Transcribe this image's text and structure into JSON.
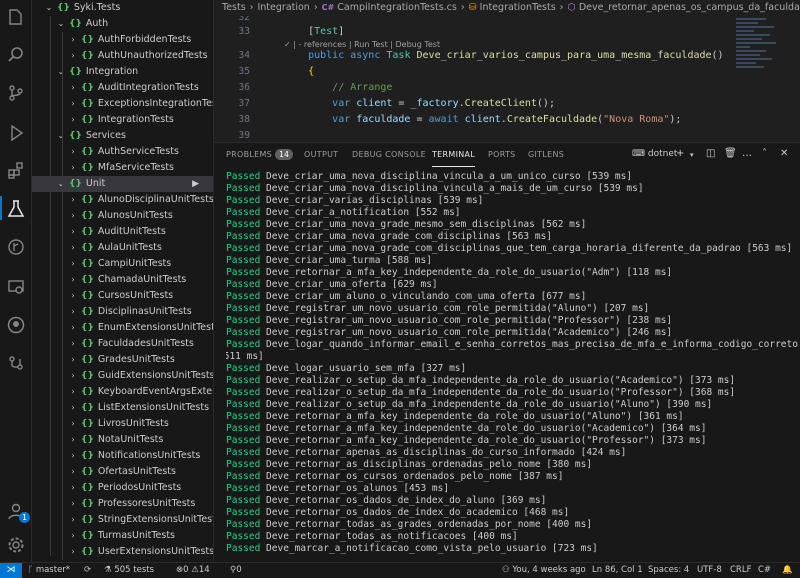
{
  "sidebar": {
    "items": [
      {
        "label": "Syki.Tests",
        "level": 0,
        "open": true
      },
      {
        "label": "Auth",
        "level": 1,
        "open": true
      },
      {
        "label": "AuthForbiddenTests",
        "level": 2
      },
      {
        "label": "AuthUnauthorizedTests",
        "level": 2
      },
      {
        "label": "Integration",
        "level": 1,
        "open": true
      },
      {
        "label": "AuditIntegrationTests",
        "level": 2
      },
      {
        "label": "ExceptionsIntegrationTests",
        "level": 2
      },
      {
        "label": "IntegrationTests",
        "level": 2
      },
      {
        "label": "Services",
        "level": 1,
        "open": true
      },
      {
        "label": "AuthServiceTests",
        "level": 2
      },
      {
        "label": "MfaServiceTests",
        "level": 2
      },
      {
        "label": "Unit",
        "level": 1,
        "open": true,
        "selected": true
      },
      {
        "label": "AlunoDisciplinaUnitTests",
        "level": 2
      },
      {
        "label": "AlunosUnitTests",
        "level": 2
      },
      {
        "label": "AuditUnitTests",
        "level": 2
      },
      {
        "label": "AulaUnitTests",
        "level": 2
      },
      {
        "label": "CampiUnitTests",
        "level": 2
      },
      {
        "label": "ChamadaUnitTests",
        "level": 2
      },
      {
        "label": "CursosUnitTests",
        "level": 2
      },
      {
        "label": "DisciplinasUnitTests",
        "level": 2
      },
      {
        "label": "EnumExtensionsUnitTests",
        "level": 2
      },
      {
        "label": "FaculdadesUnitTests",
        "level": 2
      },
      {
        "label": "GradesUnitTests",
        "level": 2
      },
      {
        "label": "GuidExtensionsUnitTests",
        "level": 2
      },
      {
        "label": "KeyboardEventArgsExten...",
        "level": 2
      },
      {
        "label": "ListExtensionsUnitTests",
        "level": 2
      },
      {
        "label": "LivrosUnitTests",
        "level": 2
      },
      {
        "label": "NotaUnitTests",
        "level": 2
      },
      {
        "label": "NotificationsUnitTests",
        "level": 2
      },
      {
        "label": "OfertasUnitTests",
        "level": 2
      },
      {
        "label": "PeriodosUnitTests",
        "level": 2
      },
      {
        "label": "ProfessoresUnitTests",
        "level": 2
      },
      {
        "label": "StringExtensionsUnitTests",
        "level": 2
      },
      {
        "label": "TurmasUnitTests",
        "level": 2
      },
      {
        "label": "UserExtensionsUnitTests",
        "level": 2
      }
    ]
  },
  "breadcrumb": {
    "p1": "Tests",
    "p2": "Integration",
    "file_icon": "C#",
    "file": "CampiIntegrationTests.cs",
    "cls": "IntegrationTests",
    "method": "Deve_retornar_apenas_os_campus_da_faculdade_do_usuario"
  },
  "editor": {
    "lines": [
      {
        "num": "32",
        "parts": []
      },
      {
        "num": "33",
        "parts": [
          {
            "t": "    ",
            "c": "pun"
          },
          {
            "t": "[",
            "c": "pun"
          },
          {
            "t": "Test",
            "c": "ty"
          },
          {
            "t": "]",
            "c": "pun"
          }
        ]
      },
      {
        "num": "34",
        "parts": [
          {
            "t": "    ",
            "c": "pun"
          },
          {
            "t": "public",
            "c": "kw"
          },
          {
            "t": " ",
            "c": "pun"
          },
          {
            "t": "async",
            "c": "kw"
          },
          {
            "t": " ",
            "c": "pun"
          },
          {
            "t": "Task",
            "c": "ty"
          },
          {
            "t": " ",
            "c": "pun"
          },
          {
            "t": "Deve_criar_varios_campus_para_uma_mesma_faculdade",
            "c": "fn"
          },
          {
            "t": "()",
            "c": "pun"
          }
        ]
      },
      {
        "num": "35",
        "parts": [
          {
            "t": "    ",
            "c": "pun"
          },
          {
            "t": "{",
            "c": "br"
          }
        ]
      },
      {
        "num": "36",
        "parts": [
          {
            "t": "        ",
            "c": "pun"
          },
          {
            "t": "// Arrange",
            "c": "cm"
          }
        ]
      },
      {
        "num": "37",
        "parts": [
          {
            "t": "        ",
            "c": "pun"
          },
          {
            "t": "var",
            "c": "kw"
          },
          {
            "t": " ",
            "c": "pun"
          },
          {
            "t": "client",
            "c": "vr"
          },
          {
            "t": " = ",
            "c": "pun"
          },
          {
            "t": "_factory",
            "c": "vr"
          },
          {
            "t": ".",
            "c": "pun"
          },
          {
            "t": "CreateClient",
            "c": "fn"
          },
          {
            "t": "();",
            "c": "pun"
          }
        ]
      },
      {
        "num": "38",
        "parts": [
          {
            "t": "        ",
            "c": "pun"
          },
          {
            "t": "var",
            "c": "kw"
          },
          {
            "t": " ",
            "c": "pun"
          },
          {
            "t": "faculdade",
            "c": "vr"
          },
          {
            "t": " = ",
            "c": "pun"
          },
          {
            "t": "await",
            "c": "kw"
          },
          {
            "t": " ",
            "c": "pun"
          },
          {
            "t": "client",
            "c": "vr"
          },
          {
            "t": ".",
            "c": "pun"
          },
          {
            "t": "CreateFaculdade",
            "c": "fn"
          },
          {
            "t": "(",
            "c": "pun"
          },
          {
            "t": "\"Nova Roma\"",
            "c": "st"
          },
          {
            "t": ");",
            "c": "pun"
          }
        ]
      },
      {
        "num": "39",
        "parts": []
      }
    ],
    "codelens": "✓ | - references | Run Test | Debug Test"
  },
  "panel": {
    "tabs": [
      "PROBLEMS",
      "OUTPUT",
      "DEBUG CONSOLE",
      "TERMINAL",
      "PORTS",
      "GITLENS"
    ],
    "problems_count": "14",
    "active_tab": "TERMINAL",
    "shell": "dotnet"
  },
  "terminal": {
    "lines": [
      {
        "s": "Passed",
        "t": " Deve_criar_uma_nova_disciplina_vincula_a_um_unico_curso [539 ms]"
      },
      {
        "s": "Passed",
        "t": " Deve_criar_uma_nova_disciplina_vincula_a_mais_de_um_curso [539 ms]"
      },
      {
        "s": "Passed",
        "t": " Deve_criar_varias_disciplinas [539 ms]"
      },
      {
        "s": "Passed",
        "t": " Deve_criar_a_notification [552 ms]"
      },
      {
        "s": "Passed",
        "t": " Deve_criar_uma_nova_grade_mesmo_sem_disciplinas [562 ms]"
      },
      {
        "s": "Passed",
        "t": " Deve_criar_uma_nova_grade_com_disciplinas [563 ms]"
      },
      {
        "s": "Passed",
        "t": " Deve_criar_uma_nova_grade_com_disciplinas_que_tem_carga_horaria_diferente_da_padrao [563 ms]"
      },
      {
        "s": "Passed",
        "t": " Deve_criar_uma_turma [588 ms]"
      },
      {
        "s": "Passed",
        "t": " Deve_retornar_a_mfa_key_independente_da_role_do_usuario(\"Adm\") [118 ms]"
      },
      {
        "s": "Passed",
        "t": " Deve_criar_uma_oferta [629 ms]"
      },
      {
        "s": "Passed",
        "t": " Deve_criar_um_aluno_o_vinculando_com_uma_oferta [677 ms]"
      },
      {
        "s": "Passed",
        "t": " Deve_registrar_um_novo_usuario_com_role_permitida(\"Aluno\") [207 ms]"
      },
      {
        "s": "Passed",
        "t": " Deve_registrar_um_novo_usuario_com_role_permitida(\"Professor\") [238 ms]"
      },
      {
        "s": "Passed",
        "t": " Deve_registrar_um_novo_usuario_com_role_permitida(\"Academico\") [246 ms]"
      },
      {
        "s": "Passed",
        "t": " Deve_logar_quando_informar_email_e_senha_corretos_mas_precisa_de_mfa_e_informa_codigo_correto"
      },
      {
        "s": "",
        "t": "[511 ms]"
      },
      {
        "s": "Passed",
        "t": " Deve_logar_usuario_sem_mfa [327 ms]"
      },
      {
        "s": "Passed",
        "t": " Deve_realizar_o_setup_da_mfa_independente_da_role_do_usuario(\"Academico\") [373 ms]"
      },
      {
        "s": "Passed",
        "t": " Deve_realizar_o_setup_da_mfa_independente_da_role_do_usuario(\"Professor\") [368 ms]"
      },
      {
        "s": "Passed",
        "t": " Deve_realizar_o_setup_da_mfa_independente_da_role_do_usuario(\"Aluno\") [390 ms]"
      },
      {
        "s": "Passed",
        "t": " Deve_retornar_a_mfa_key_independente_da_role_do_usuario(\"Aluno\") [361 ms]"
      },
      {
        "s": "Passed",
        "t": " Deve_retornar_a_mfa_key_independente_da_role_do_usuario(\"Academico\") [364 ms]"
      },
      {
        "s": "Passed",
        "t": " Deve_retornar_a_mfa_key_independente_da_role_do_usuario(\"Professor\") [373 ms]"
      },
      {
        "s": "Passed",
        "t": " Deve_retornar_apenas_as_disciplinas_do_curso_informado [424 ms]"
      },
      {
        "s": "Passed",
        "t": " Deve_retornar_as_disciplinas_ordenadas_pelo_nome [380 ms]"
      },
      {
        "s": "Passed",
        "t": " Deve_retornar_os_cursos_ordenados_pelo_nome [387 ms]"
      },
      {
        "s": "Passed",
        "t": " Deve_retornar_os_alunos [453 ms]"
      },
      {
        "s": "Passed",
        "t": " Deve_retornar_os_dados_de_index_do_aluno [369 ms]"
      },
      {
        "s": "Passed",
        "t": " Deve_retornar_os_dados_de_index_do_academico [468 ms]"
      },
      {
        "s": "Passed",
        "t": " Deve_retornar_todas_as_grades_ordenadas_por_nome [400 ms]"
      },
      {
        "s": "Passed",
        "t": " Deve_retornar_todas_as_notificacoes [400 ms]"
      },
      {
        "s": "Passed",
        "t": " Deve_marcar_a_notificacao_como_vista_pelo_usuario [723 ms]"
      }
    ]
  },
  "statusbar": {
    "branch": "master*",
    "tests": "505 tests",
    "errors": "0",
    "warnings": "14",
    "ports": "0",
    "blame": "You, 4 weeks ago",
    "position": "Ln 86, Col 1",
    "spaces": "Spaces: 4",
    "encoding": "UTF-8",
    "eol": "CRLF",
    "lang": "C#"
  },
  "activity": {
    "icons": [
      "explorer-icon",
      "search-icon",
      "source-control-icon",
      "run-debug-icon",
      "extensions-icon",
      "testing-icon",
      "git-graph-icon",
      "remote-explorer-icon",
      "github-icon",
      "gitlens-icon"
    ],
    "account_badge": "1"
  },
  "colors": {
    "accent": "#0078d4",
    "passed": "#23d18b",
    "selection": "#37373d"
  }
}
